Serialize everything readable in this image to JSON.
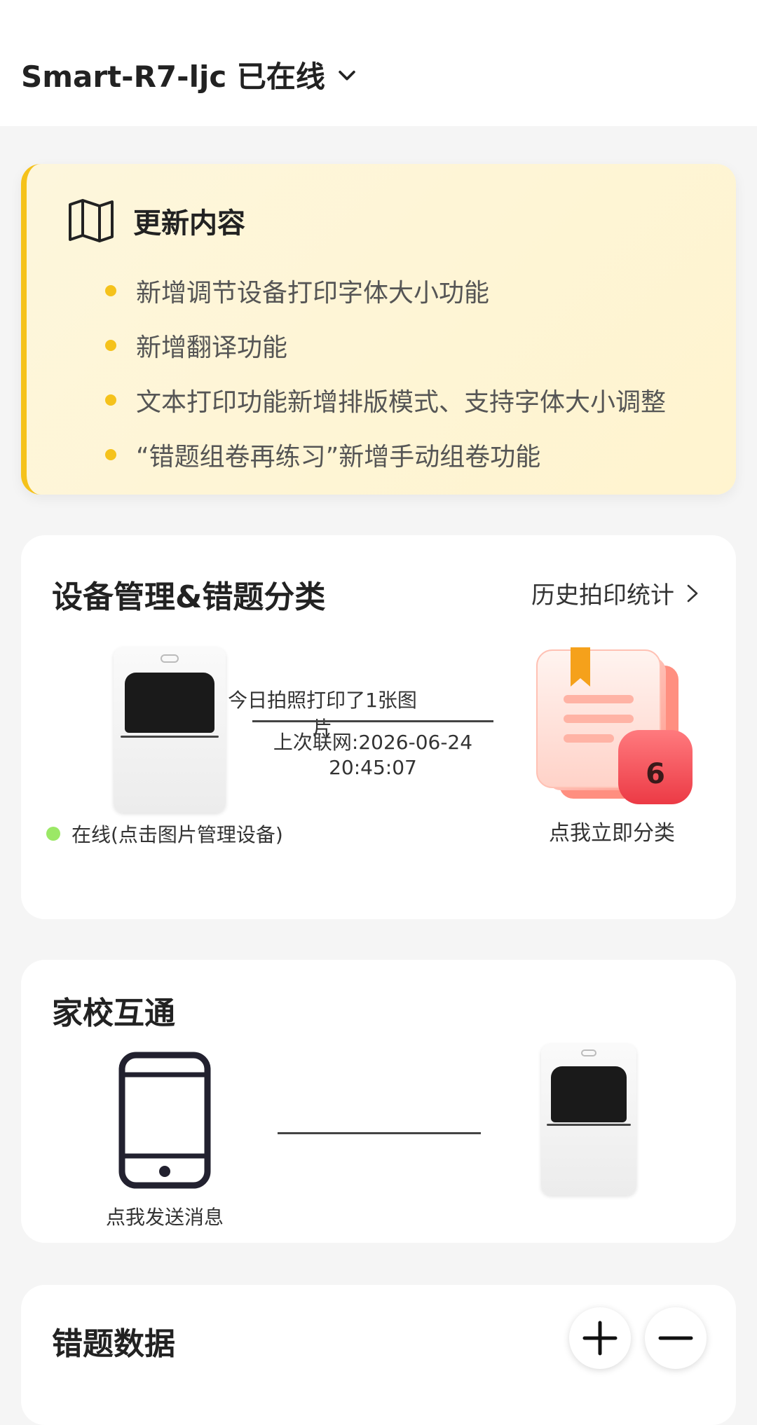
{
  "header": {
    "device_title": "Smart-R7-ljc 已在线"
  },
  "update": {
    "title": "更新内容",
    "items": [
      "新增调节设备打印字体大小功能",
      "新增翻译功能",
      "文本打印功能新增排版模式、支持字体大小调整",
      "“错题组卷再练习”新增手动组卷功能"
    ]
  },
  "device_card": {
    "title": "设备管理&错题分类",
    "history_link": "历史拍印统计",
    "today_text": "今日拍照打印了1张图片",
    "last_online_line1": "上次联网:2026-06-24",
    "last_online_line2": "20:45:07",
    "status_text": "在线(点击图片管理设备)",
    "badge_count": "6",
    "classify_label": "点我立即分类"
  },
  "home_school": {
    "title": "家校互通",
    "send_label": "点我发送消息"
  },
  "wrong_question": {
    "title": "错题数据"
  },
  "colors": {
    "accent_yellow": "#f5c21b",
    "online_green": "#9be866",
    "badge_red": "#f0474f"
  }
}
